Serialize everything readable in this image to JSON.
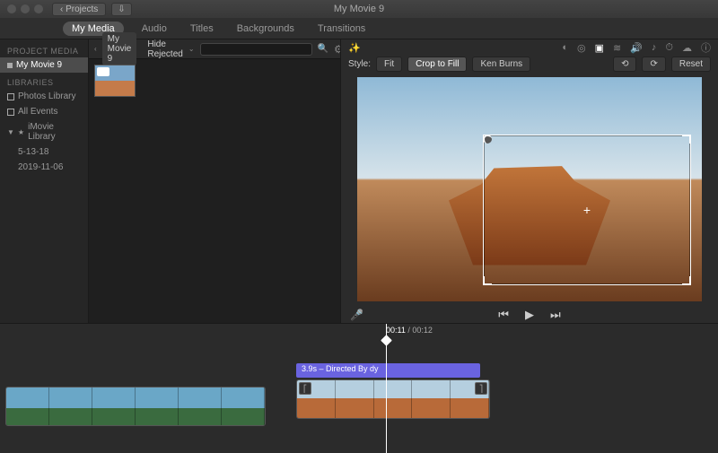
{
  "titlebar": {
    "back_label": "Projects",
    "window_title": "My Movie 9"
  },
  "tabs": [
    "My Media",
    "Audio",
    "Titles",
    "Backgrounds",
    "Transitions"
  ],
  "active_tab_index": 0,
  "sidebar": {
    "project_media": "PROJECT MEDIA",
    "project_items": [
      "My Movie 9"
    ],
    "libraries": "LIBRARIES",
    "library_items": [
      "Photos Library",
      "All Events",
      "iMovie Library"
    ],
    "sub_items": [
      "5-13-18",
      "2019-11-06"
    ]
  },
  "browser": {
    "context": "My Movie 9",
    "filter_label": "Hide Rejected",
    "search_placeholder": ""
  },
  "viewer": {
    "style_label": "Style:",
    "segments": [
      "Fit",
      "Crop to Fill",
      "Ken Burns"
    ],
    "active_segment_index": 1,
    "reset_label": "Reset"
  },
  "timeline": {
    "current_time": "00:11",
    "total_time": "00:12",
    "title_clip": "3.9s – Directed By dy"
  }
}
